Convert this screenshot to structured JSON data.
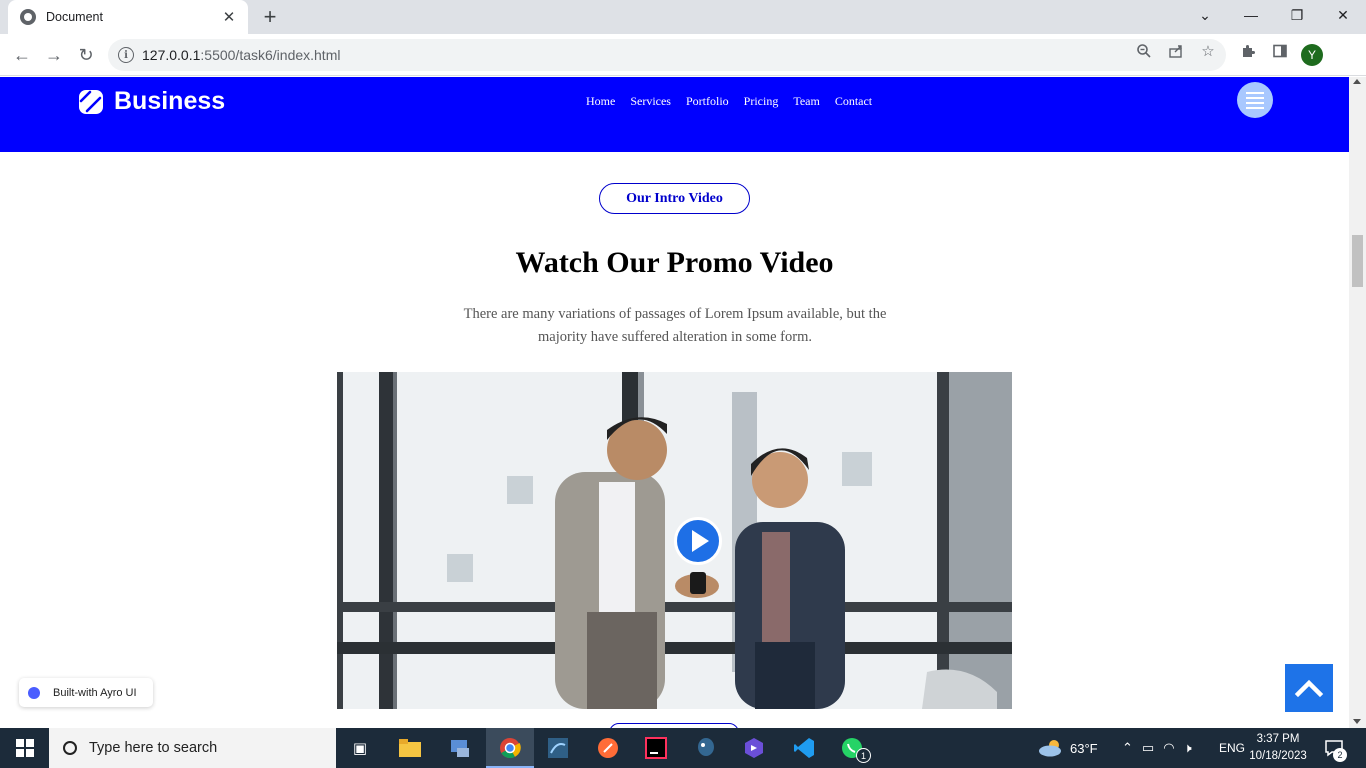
{
  "browser": {
    "tab_title": "Document",
    "url_host": "127.0.0.1",
    "url_rest": ":5500/task6/index.html",
    "profile_initial": "Y"
  },
  "site": {
    "brand": "Business",
    "nav": [
      "Home",
      "Services",
      "Portfolio",
      "Pricing",
      "Team",
      "Contact"
    ],
    "section_badge": "Our Intro Video",
    "heading": "Watch Our Promo Video",
    "subtext": "There are many variations of passages of Lorem Ipsum available, but the majority have suffered alteration in some form.",
    "built_with": "Built-with Ayro UI",
    "colors": {
      "header": "#0000ff",
      "accent": "#1e73e8",
      "badge": "#0000cc"
    }
  },
  "taskbar": {
    "search_placeholder": "Type here to search",
    "weather": "63°F",
    "language": "ENG",
    "time": "3:37 PM",
    "date": "10/18/2023",
    "notification_count": "2",
    "whatsapp_badge": "1"
  }
}
